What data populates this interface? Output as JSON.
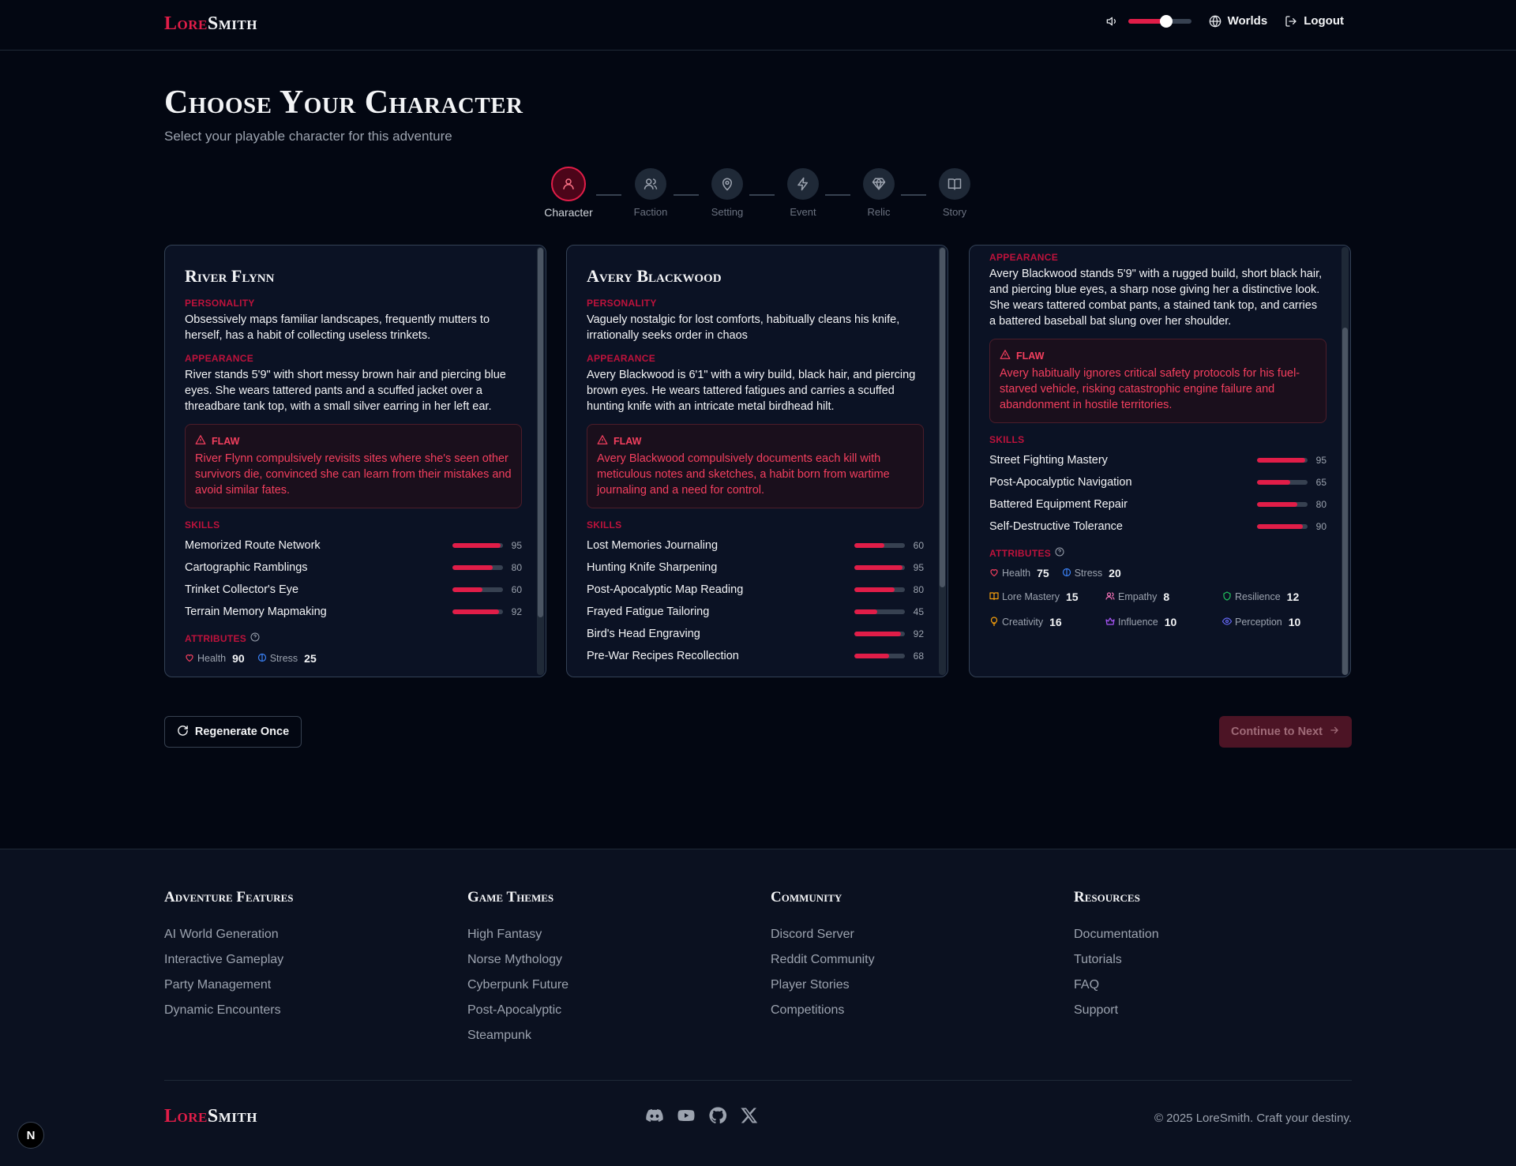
{
  "brand": {
    "part1": "Lore",
    "part2": "Smith"
  },
  "header": {
    "volume_level": 0.6,
    "worlds_label": "Worlds",
    "logout_label": "Logout"
  },
  "page": {
    "title": "Choose Your Character",
    "subtitle": "Select your playable character for this adventure"
  },
  "steps": [
    {
      "label": "Character",
      "icon": "user-icon",
      "active": true
    },
    {
      "label": "Faction",
      "icon": "users-icon",
      "active": false
    },
    {
      "label": "Setting",
      "icon": "map-pin-icon",
      "active": false
    },
    {
      "label": "Event",
      "icon": "lightning-icon",
      "active": false
    },
    {
      "label": "Relic",
      "icon": "gem-icon",
      "active": false
    },
    {
      "label": "Story",
      "icon": "book-icon",
      "active": false
    }
  ],
  "labels": {
    "personality": "Personality",
    "appearance": "Appearance",
    "flaw": "Flaw",
    "skills": "Skills",
    "attributes": "Attributes"
  },
  "cards": [
    {
      "name": "River Flynn",
      "personality": "Obsessively maps familiar landscapes, frequently mutters to herself, has a habit of collecting useless trinkets.",
      "appearance": "River stands 5'9\" with short messy brown hair and piercing blue eyes. She wears tattered pants and a scuffed jacket over a threadbare tank top, with a small silver earring in her left ear.",
      "flaw": "River Flynn compulsively revisits sites where she's seen other survivors die, convinced she can learn from their mistakes and avoid similar fates.",
      "skills": [
        {
          "name": "Memorized Route Network",
          "value": 95
        },
        {
          "name": "Cartographic Ramblings",
          "value": 80
        },
        {
          "name": "Trinket Collector's Eye",
          "value": 60
        },
        {
          "name": "Terrain Memory Mapmaking",
          "value": 92
        }
      ],
      "health_label": "Health",
      "health": "90",
      "stress_label": "Stress",
      "stress": "25"
    },
    {
      "name": "Avery Blackwood",
      "personality": "Vaguely nostalgic for lost comforts, habitually cleans his knife, irrationally seeks order in chaos",
      "appearance": "Avery Blackwood is 6'1\" with a wiry build, black hair, and piercing brown eyes. He wears tattered fatigues and carries a scuffed hunting knife with an intricate metal birdhead hilt.",
      "flaw": "Avery Blackwood compulsively documents each kill with meticulous notes and sketches, a habit born from wartime journaling and a need for control.",
      "skills": [
        {
          "name": "Lost Memories Journaling",
          "value": 60
        },
        {
          "name": "Hunting Knife Sharpening",
          "value": 95
        },
        {
          "name": "Post-Apocalyptic Map Reading",
          "value": 80
        },
        {
          "name": "Frayed Fatigue Tailoring",
          "value": 45
        },
        {
          "name": "Bird's Head Engraving",
          "value": 92
        },
        {
          "name": "Pre-War Recipes Recollection",
          "value": 68
        }
      ]
    },
    {
      "appearance": "Avery Blackwood stands 5'9\" with a rugged build, short black hair, and piercing blue eyes, a sharp nose giving her a distinctive look. She wears tattered combat pants, a stained tank top, and carries a battered baseball bat slung over her shoulder.",
      "flaw": "Avery habitually ignores critical safety protocols for his fuel-starved vehicle, risking catastrophic engine failure and abandonment in hostile territories.",
      "skills": [
        {
          "name": "Street Fighting Mastery",
          "value": 95
        },
        {
          "name": "Post-Apocalyptic Navigation",
          "value": 65
        },
        {
          "name": "Battered Equipment Repair",
          "value": 80
        },
        {
          "name": "Self-Destructive Tolerance",
          "value": 90
        }
      ],
      "health_label": "Health",
      "health": "75",
      "stress_label": "Stress",
      "stress": "20",
      "stats": [
        {
          "label": "Lore Mastery",
          "value": "15",
          "icon": "book-icon",
          "color": "#f59e0b"
        },
        {
          "label": "Empathy",
          "value": "8",
          "icon": "users-icon",
          "color": "#f472b6"
        },
        {
          "label": "Resilience",
          "value": "12",
          "icon": "shield-icon",
          "color": "#22c55e"
        },
        {
          "label": "Creativity",
          "value": "16",
          "icon": "lightbulb-icon",
          "color": "#f59e0b"
        },
        {
          "label": "Influence",
          "value": "10",
          "icon": "crown-icon",
          "color": "#a855f7"
        },
        {
          "label": "Perception",
          "value": "10",
          "icon": "eye-icon",
          "color": "#6366f1"
        }
      ]
    }
  ],
  "actions": {
    "regenerate": "Regenerate Once",
    "continue": "Continue to Next"
  },
  "footer": {
    "columns": [
      {
        "title": "Adventure Features",
        "links": [
          "AI World Generation",
          "Interactive Gameplay",
          "Party Management",
          "Dynamic Encounters"
        ]
      },
      {
        "title": "Game Themes",
        "links": [
          "High Fantasy",
          "Norse Mythology",
          "Cyberpunk Future",
          "Post-Apocalyptic",
          "Steampunk"
        ]
      },
      {
        "title": "Community",
        "links": [
          "Discord Server",
          "Reddit Community",
          "Player Stories",
          "Competitions"
        ]
      },
      {
        "title": "Resources",
        "links": [
          "Documentation",
          "Tutorials",
          "FAQ",
          "Support"
        ]
      }
    ],
    "socials": [
      "discord-icon",
      "youtube-icon",
      "github-icon",
      "x-icon"
    ],
    "copyright": "© 2025 LoreSmith. Craft your destiny."
  },
  "badge": "N",
  "colors": {
    "accent": "#e11d48",
    "background": "#030712",
    "card": "#0b1224"
  }
}
